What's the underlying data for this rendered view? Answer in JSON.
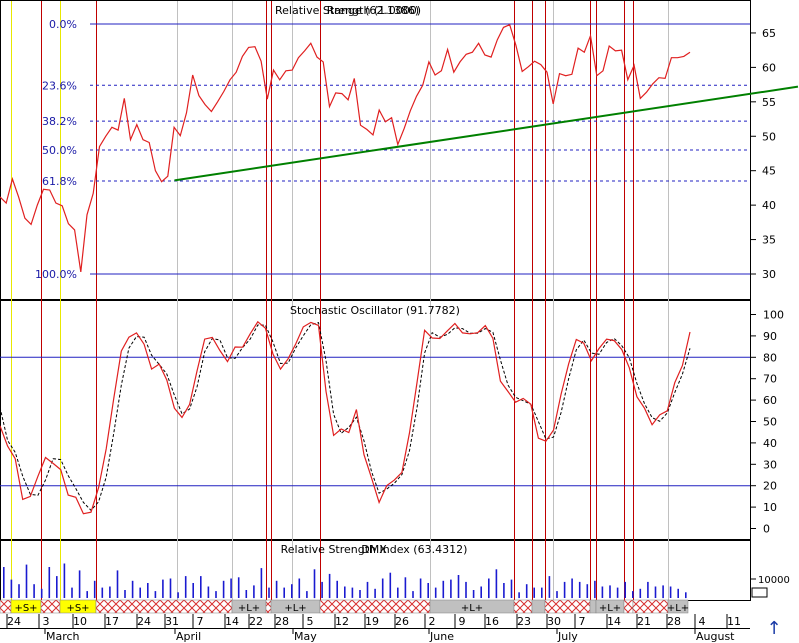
{
  "chart_data": [
    {
      "type": "line",
      "title": "Relative Strength (1.0000)",
      "overlay_title": "Range (62.1386)",
      "ylim": [
        25,
        70
      ],
      "y_ticks": [
        "65",
        "60",
        "55",
        "50",
        "45",
        "40",
        "35",
        "30"
      ],
      "fib_levels": [
        {
          "label": "0.0%",
          "value": 66.3
        },
        {
          "label": "23.6%",
          "value": 57.4
        },
        {
          "label": "38.2%",
          "value": 52.2
        },
        {
          "label": "50.0%",
          "value": 48.0
        },
        {
          "label": "61.8%",
          "value": 43.5
        },
        {
          "label": "100.0%",
          "value": 30.0
        }
      ],
      "trendline": [
        {
          "x": 0.2184,
          "y": 43.6
        },
        {
          "x": 0.9987,
          "y": 57.2
        }
      ],
      "series": [
        {
          "values": [
            41.2,
            40.3,
            43.8,
            41.2,
            38.1,
            37.2,
            40.0,
            42.3,
            42.2,
            40.3,
            39.9,
            37.3,
            36.4,
            30.3,
            38.6,
            41.7,
            48.5,
            50.0,
            51.3,
            50.9,
            55.5,
            49.5,
            51.7,
            49.5,
            49.1,
            45.0,
            43.4,
            44.2,
            51.3,
            50.1,
            53.4,
            58.9,
            55.9,
            54.6,
            53.6,
            55.0,
            56.5,
            58.2,
            59.3,
            61.6,
            62.9,
            63.0,
            60.9,
            55.4,
            59.6,
            58.2,
            59.5,
            59.6,
            61.4,
            62.4,
            63.5,
            61.5,
            60.8,
            54.3,
            56.3,
            56.2,
            55.3,
            58.4,
            51.6,
            51.0,
            50.2,
            53.8,
            52.1,
            52.7,
            48.8,
            51.1,
            53.7,
            55.8,
            57.4,
            60.8,
            58.9,
            59.5,
            62.6,
            59.3,
            60.8,
            61.9,
            62.2,
            63.5,
            61.8,
            61.5,
            64.0,
            65.8,
            66.2,
            63.2,
            59.4,
            60.1,
            60.9,
            60.4,
            59.3,
            54.7,
            59.1,
            58.8,
            59.0,
            62.8,
            62.2,
            64.6,
            58.8,
            59.5,
            63.1,
            62.4,
            62.5,
            58.2,
            60.3,
            55.5,
            56.4,
            57.6,
            58.5,
            58.4,
            61.4,
            61.4,
            61.6,
            62.2
          ]
        }
      ]
    },
    {
      "type": "line",
      "title": "Stochastic Oscillator (91.7782)",
      "ylim": [
        -5,
        105
      ],
      "y_ticks": [
        "100",
        "90",
        "80",
        "70",
        "60",
        "50",
        "40",
        "30",
        "20",
        "10",
        "0"
      ],
      "ref_lines": [
        80,
        20
      ],
      "series": [
        {
          "name": "%K",
          "values": [
            48.0,
            38.5,
            32.6,
            13.6,
            15.0,
            24.4,
            33.2,
            30.4,
            27.5,
            15.6,
            14.6,
            6.9,
            7.6,
            19.1,
            37.2,
            60.6,
            82.9,
            89.4,
            91.4,
            86.1,
            74.5,
            76.8,
            69.4,
            56.2,
            51.9,
            58.0,
            73.8,
            88.5,
            89.3,
            83.2,
            78.0,
            84.8,
            84.7,
            91.0,
            96.6,
            93.6,
            81.5,
            74.5,
            79.3,
            86.2,
            94.2,
            96.3,
            94.9,
            64.1,
            43.5,
            46.5,
            44.8,
            55.6,
            34.5,
            23.7,
            12.2,
            20.0,
            22.6,
            26.2,
            44.7,
            68.2,
            92.6,
            89.0,
            88.8,
            92.4,
            95.8,
            91.4,
            91.0,
            91.5,
            94.8,
            88.9,
            68.9,
            64.0,
            59.0,
            60.8,
            58.1,
            42.2,
            40.8,
            46.0,
            62.8,
            77.0,
            88.3,
            86.6,
            78.4,
            84.1,
            88.5,
            87.8,
            83.6,
            75.1,
            61.6,
            56.2,
            48.5,
            53.1,
            55.0,
            68.2,
            76.1,
            91.8
          ]
        },
        {
          "name": "%D",
          "values": [
            56.6,
            41.1,
            35.6,
            24.5,
            16.0,
            15.5,
            22.6,
            32.6,
            32.2,
            24.7,
            18.7,
            12.2,
            8.5,
            12.5,
            24.0,
            44.4,
            66.9,
            84.3,
            89.7,
            89.4,
            81.0,
            76.7,
            72.2,
            62.3,
            53.6,
            55.8,
            66.3,
            82.6,
            88.8,
            88.1,
            79.8,
            79.5,
            84.6,
            88.5,
            95.1,
            95.0,
            87.1,
            77.1,
            77.3,
            84.4,
            90.1,
            95.3,
            96.2,
            78.5,
            53.4,
            44.5,
            47.3,
            52.0,
            41.0,
            26.7,
            16.5,
            18.4,
            21.1,
            25.2,
            36.4,
            56.4,
            82.0,
            91.5,
            89.4,
            90.7,
            93.8,
            93.4,
            91.2,
            91.2,
            93.4,
            91.7,
            78.8,
            67.0,
            61.3,
            59.7,
            58.1,
            50.0,
            41.8,
            42.7,
            54.2,
            70.1,
            83.5,
            88.1,
            82.0,
            81.4,
            86.9,
            88.8,
            85.4,
            79.8,
            67.8,
            58.3,
            51.8,
            50.1,
            54.0,
            63.6,
            72.1,
            84.2
          ]
        }
      ]
    },
    {
      "type": "bar",
      "title": "Relative Strength Index (63.4312)",
      "overlay_title": "DMX",
      "y_ticks": [
        "10000"
      ],
      "values": [
        2.7,
        1.6,
        1.2,
        2.9,
        1.2,
        0.8,
        2.7,
        1.9,
        3.0,
        0.9,
        2.4,
        0.6,
        1.5,
        0.9,
        1.0,
        2.4,
        0.7,
        1.5,
        0.9,
        1.3,
        0.6,
        1.6,
        1.7,
        0.5,
        1.9,
        1.3,
        1.9,
        1.0,
        0.6,
        1.5,
        1.7,
        1.8,
        0.7,
        1.1,
        2.6,
        0.9,
        1.5,
        0.9,
        1.2,
        1.7,
        0.6,
        2.5,
        1.4,
        2.1,
        1.5,
        1.0,
        0.9,
        0.7,
        1.4,
        0.8,
        1.7,
        2.2,
        0.9,
        1.8,
        0.6,
        1.7,
        1.3,
        0.9,
        1.5,
        1.6,
        2.0,
        1.4,
        0.7,
        1.0,
        1.7,
        2.5,
        1.3,
        1.6,
        0.5,
        1.2,
        0.9,
        0.9,
        1.9,
        0.6,
        1.4,
        1.7,
        1.4,
        1.2,
        1.5,
        1.0,
        1.1,
        0.9,
        1.4,
        0.6,
        0.8,
        1.4,
        1.0,
        1.1,
        1.0,
        0.8,
        0.5
      ]
    }
  ],
  "signals": [
    "+S+",
    "+S+",
    "+L+",
    "+L+",
    "+L+",
    "+L+",
    "+L+"
  ],
  "x_axis": {
    "day_labels": [
      "24",
      "3",
      "10",
      "17",
      "24",
      "31",
      "7",
      "14",
      "22",
      "28",
      "5",
      "12",
      "19",
      "26",
      "2",
      "9",
      "16",
      "23",
      "30",
      "7",
      "14",
      "21",
      "28",
      "4",
      "11"
    ],
    "month_labels": [
      "March",
      "April",
      "May",
      "June",
      "July",
      "August"
    ]
  },
  "colors": {
    "price_line": "#e02020",
    "trendline": "#008000",
    "fib_line": "#2020c0",
    "red_marker": "#c00000",
    "yellow_marker": "#e8e800",
    "grey_marker": "#c0c0c0",
    "volume_bar": "#1a1ad0"
  },
  "ui": {
    "scroll_up_icon": "up-arrow-icon"
  }
}
